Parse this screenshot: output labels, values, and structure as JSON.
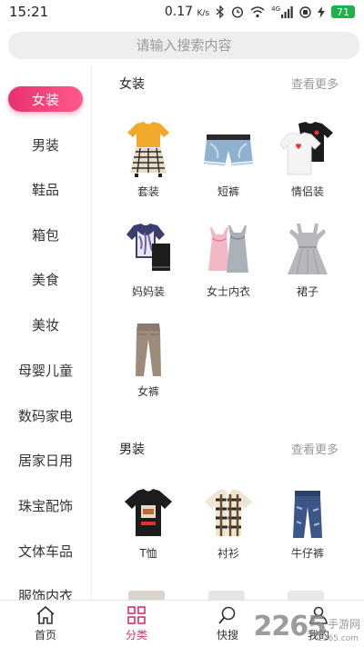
{
  "status_bar": {
    "time": "15:21",
    "net_speed": "0.17",
    "net_unit": "K/s",
    "signal_label": "4G",
    "battery": "71"
  },
  "search": {
    "placeholder": "请输入搜索内容"
  },
  "sidebar": {
    "active_index": 0,
    "items": [
      "女装",
      "男装",
      "鞋品",
      "箱包",
      "美食",
      "美妆",
      "母婴儿童",
      "数码家电",
      "居家日用",
      "珠宝配饰",
      "文体车品",
      "服饰内衣"
    ]
  },
  "sections": [
    {
      "title": "女装",
      "more": "查看更多",
      "items": [
        {
          "label": "套装",
          "icon": "outfit-set-icon"
        },
        {
          "label": "短裤",
          "icon": "shorts-icon"
        },
        {
          "label": "情侣装",
          "icon": "couple-tshirt-icon"
        },
        {
          "label": "妈妈装",
          "icon": "mom-outfit-icon"
        },
        {
          "label": "女士内衣",
          "icon": "camisole-icon"
        },
        {
          "label": "裙子",
          "icon": "dress-icon"
        },
        {
          "label": "女裤",
          "icon": "trousers-icon"
        }
      ]
    },
    {
      "title": "男装",
      "more": "查看更多",
      "items": [
        {
          "label": "T恤",
          "icon": "tshirt-icon"
        },
        {
          "label": "衬衫",
          "icon": "plaid-shirt-icon"
        },
        {
          "label": "牛仔裤",
          "icon": "jeans-icon"
        }
      ]
    }
  ],
  "tabbar": {
    "active_index": 1,
    "items": [
      {
        "label": "首页",
        "icon": "home-icon"
      },
      {
        "label": "分类",
        "icon": "category-grid-icon"
      },
      {
        "label": "快搜",
        "icon": "search-icon"
      },
      {
        "label": "我的",
        "icon": "user-icon"
      }
    ]
  },
  "watermark": {
    "brand": "2265",
    "site": "手游网",
    "domain": "2265.com"
  },
  "colors": {
    "accent": "#e8316f",
    "tab_active": "#d9306b",
    "battery": "#1fb24a"
  }
}
